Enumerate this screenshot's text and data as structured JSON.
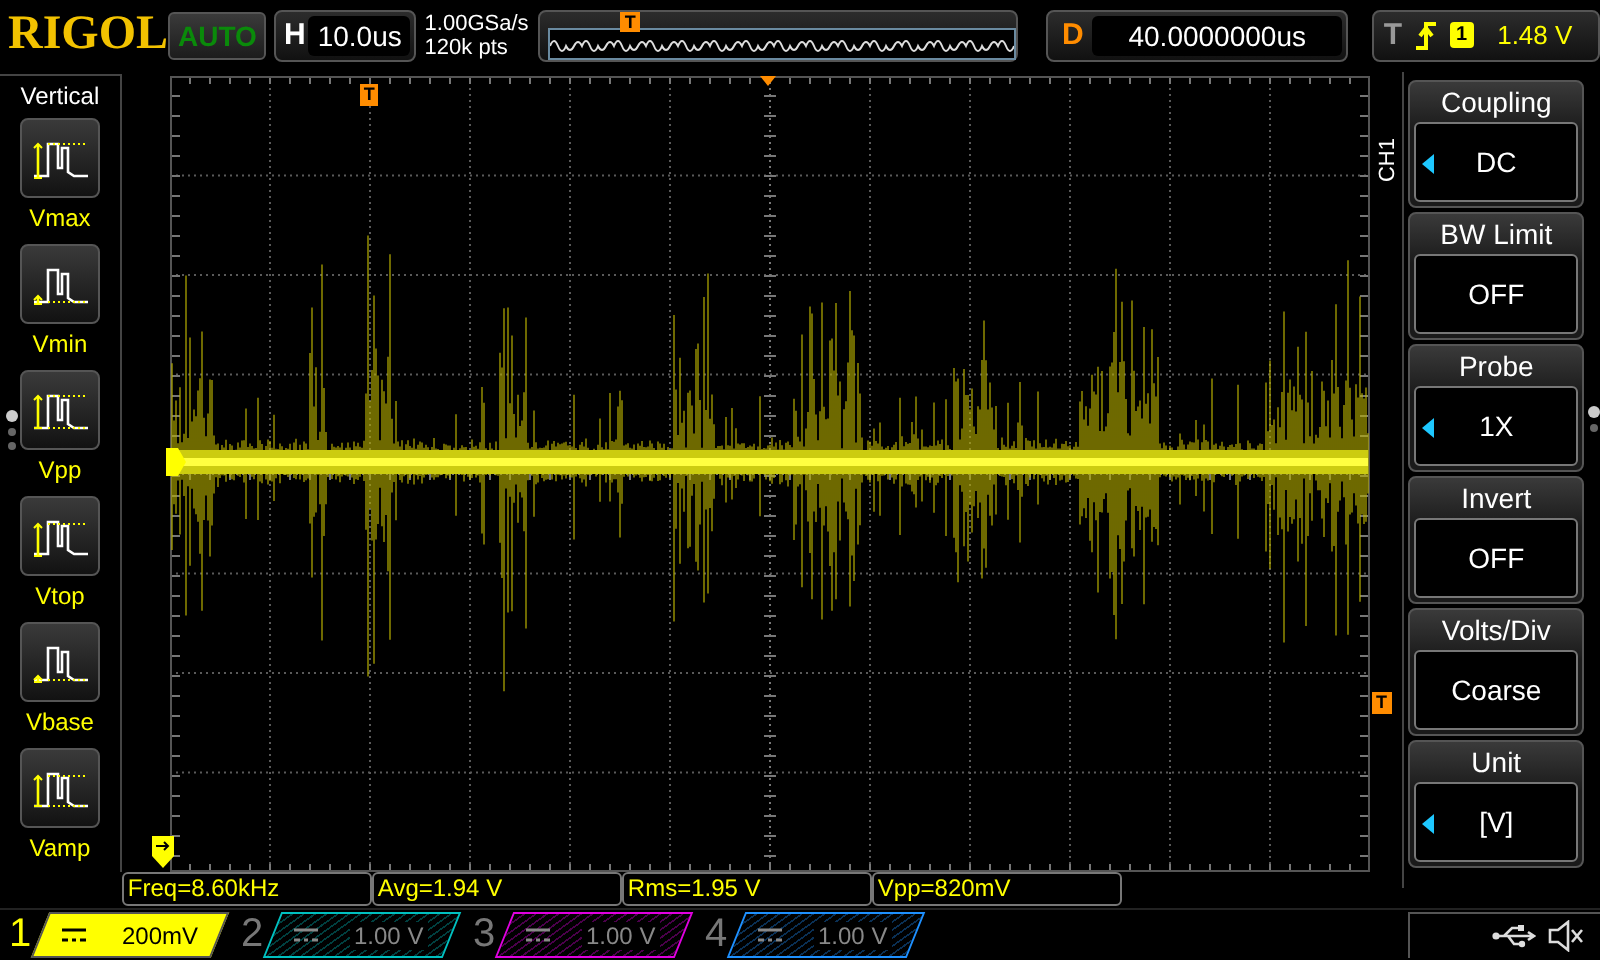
{
  "logo": "RIGOL",
  "trigger_status": "AUTO",
  "timebase": {
    "label": "H",
    "value": "10.0us"
  },
  "acquisition": {
    "sample_rate": "1.00GSa/s",
    "memory_depth": "120k pts",
    "trigger_marker": "T"
  },
  "delay": {
    "label": "D",
    "value": "40.0000000us"
  },
  "trigger": {
    "label": "T",
    "channel": "1",
    "level": "1.48 V"
  },
  "left_menu": {
    "title": "Vertical",
    "items": [
      {
        "label": "Vmax",
        "kind": "vmax"
      },
      {
        "label": "Vmin",
        "kind": "vmin"
      },
      {
        "label": "Vpp",
        "kind": "vpp"
      },
      {
        "label": "Vtop",
        "kind": "vtop"
      },
      {
        "label": "Vbase",
        "kind": "vbase"
      },
      {
        "label": "Vamp",
        "kind": "vamp"
      }
    ],
    "page_dots": [
      {
        "selected": true
      },
      {
        "selected": false
      },
      {
        "selected": false
      }
    ]
  },
  "grid": {
    "trigger_time_marker": "T",
    "trigger_level_marker": "T"
  },
  "measurements": [
    "Freq=8.60kHz",
    "Avg=1.94 V",
    "Rms=1.95 V",
    "Vpp=820mV"
  ],
  "right_menu": {
    "channel": "CH1",
    "items": [
      {
        "title": "Coupling",
        "value": "DC",
        "adjustable": true
      },
      {
        "title": "BW Limit",
        "value": "OFF",
        "adjustable": false
      },
      {
        "title": "Probe",
        "value": "1X",
        "adjustable": true
      },
      {
        "title": "Invert",
        "value": "OFF",
        "adjustable": false
      },
      {
        "title": "Volts/Div",
        "value": "Coarse",
        "adjustable": false
      },
      {
        "title": "Unit",
        "value": "[V]",
        "adjustable": true
      }
    ],
    "page_dots": [
      {
        "selected": true
      },
      {
        "selected": false
      }
    ]
  },
  "channels": [
    {
      "number": "1",
      "scale": "200mV",
      "selected": true,
      "color": "#ffff00"
    },
    {
      "number": "2",
      "scale": "1.00 V",
      "selected": false,
      "color": "#00c0c0"
    },
    {
      "number": "3",
      "scale": "1.00 V",
      "selected": false,
      "color": "#e000e0"
    },
    {
      "number": "4",
      "scale": "1.00 V",
      "selected": false,
      "color": "#1e90ff"
    }
  ]
}
